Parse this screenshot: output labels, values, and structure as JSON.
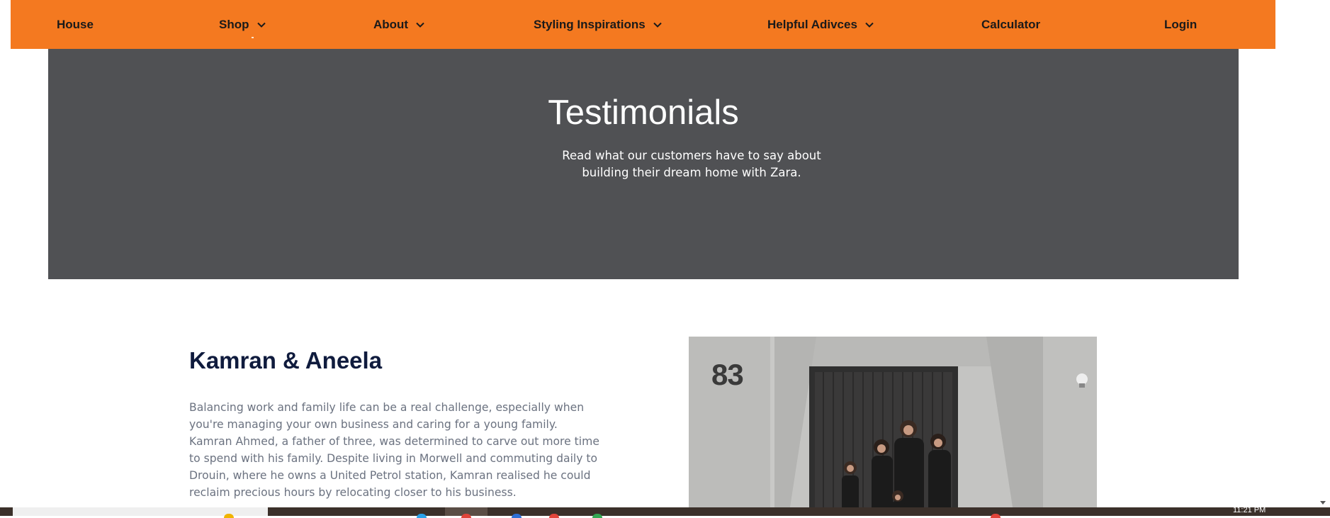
{
  "nav": {
    "items": [
      {
        "label": "House",
        "dropdown": false
      },
      {
        "label": "Shop",
        "dropdown": true
      },
      {
        "label": "About",
        "dropdown": true
      },
      {
        "label": "Styling Inspirations",
        "dropdown": true
      },
      {
        "label": "Helpful Adivces",
        "dropdown": true
      },
      {
        "label": "Calculator",
        "dropdown": false
      },
      {
        "label": "Login",
        "dropdown": false
      }
    ],
    "background": "#f47920"
  },
  "hero": {
    "title": "Testimonials",
    "subtitle": "Read what our customers have to say about building their dream home with Zara.",
    "background": "#505154"
  },
  "testimonial": {
    "name": "Kamran & Aneela",
    "body": "Balancing work and family life can be a real challenge, especially when you're managing your own business and caring for a young family. Kamran Ahmed, a father of three, was determined to carve out more time to spend with his family. Despite living in Morwell and commuting daily to Drouin, where he owns a United Petrol station, Kamran realised he could reclaim precious hours by relocating closer to his business.",
    "photo": {
      "house_number": "83"
    }
  },
  "taskbar": {
    "time": "11:21 PM"
  }
}
